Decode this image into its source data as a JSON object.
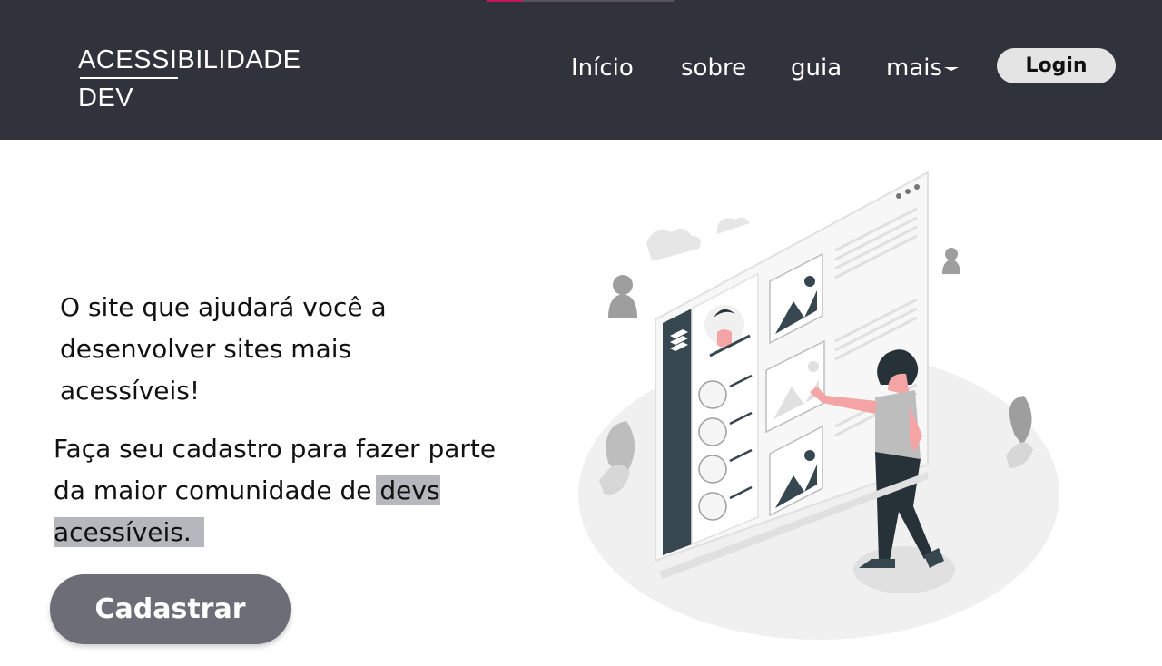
{
  "header": {
    "logo": {
      "line1": "ACESSIBILIDADE",
      "line2": "DEV"
    },
    "nav": [
      {
        "label": "Início"
      },
      {
        "label": "sobre"
      },
      {
        "label": "guia"
      },
      {
        "label": "mais"
      }
    ],
    "login_label": "Login"
  },
  "hero": {
    "headline": "O site que ajudará você a desenvolver sites mais acessíveis!",
    "subline_part1": "Faça seu cadastro para fazer parte da maior comunidade de",
    "subline_highlight": "devs acessíveis.",
    "cta_label": "Cadastrar",
    "illustration": "web-design-illustration"
  },
  "colors": {
    "header_bg": "#30323c",
    "cta_bg": "#6c6d76",
    "highlight_bg": "#b6b7bc",
    "accent_skin": "#f4a4a4",
    "dark_panel": "#37474f"
  }
}
